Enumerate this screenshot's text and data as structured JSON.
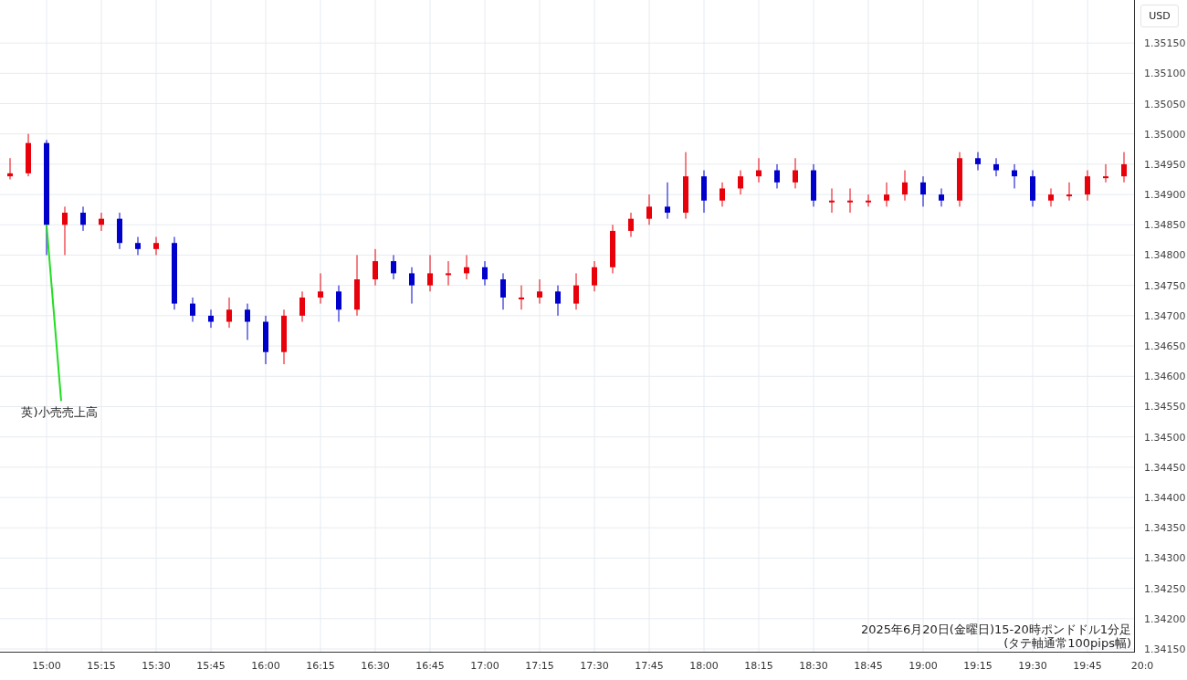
{
  "price_axis": {
    "currency": "USD"
  },
  "chart": {
    "caption": [
      "2025年6月20日(金曜日)15-20時ポンドドル1分足",
      "(タテ軸通常100pips幅)"
    ],
    "chart_data": {
      "type": "candlestick",
      "categories": [
        null,
        null,
        "15:00",
        null,
        null,
        "15:15",
        null,
        null,
        "15:30",
        null,
        null,
        "15:45",
        null,
        null,
        "16:00",
        null,
        null,
        "16:15",
        null,
        null,
        "16:30",
        null,
        null,
        "16:45",
        null,
        null,
        "17:00",
        null,
        null,
        "17:15",
        null,
        null,
        "17:30",
        null,
        null,
        "17:45",
        null,
        null,
        "18:00",
        null,
        null,
        "18:15",
        null,
        null,
        "18:30",
        null,
        null,
        "18:45",
        null,
        null,
        "19:00",
        null,
        null,
        "19:15",
        null,
        null,
        "19:30",
        null,
        null,
        "19:45",
        null,
        null,
        "20:0"
      ],
      "ohlc": [
        [
          1.3493,
          1.3496,
          1.34925,
          1.34935
        ],
        [
          1.34935,
          1.35,
          1.3493,
          1.34985
        ],
        [
          1.34985,
          1.3499,
          1.348,
          1.3485
        ],
        [
          1.3485,
          1.3488,
          1.348,
          1.3487
        ],
        [
          1.3487,
          1.3488,
          1.3484,
          1.3485
        ],
        [
          1.3485,
          1.3487,
          1.3484,
          1.3486
        ],
        [
          1.3486,
          1.3487,
          1.3481,
          1.3482
        ],
        [
          1.3482,
          1.3483,
          1.348,
          1.3481
        ],
        [
          1.3481,
          1.3483,
          1.348,
          1.3482
        ],
        [
          1.3482,
          1.3483,
          1.3471,
          1.3472
        ],
        [
          1.3472,
          1.3473,
          1.3469,
          1.347
        ],
        [
          1.347,
          1.3471,
          1.3468,
          1.3469
        ],
        [
          1.3469,
          1.3473,
          1.3468,
          1.3471
        ],
        [
          1.3471,
          1.3472,
          1.3466,
          1.3469
        ],
        [
          1.3469,
          1.347,
          1.3462,
          1.3464
        ],
        [
          1.3464,
          1.3471,
          1.3462,
          1.347
        ],
        [
          1.347,
          1.3474,
          1.3469,
          1.3473
        ],
        [
          1.3473,
          1.3477,
          1.3472,
          1.3474
        ],
        [
          1.3474,
          1.3475,
          1.3469,
          1.3471
        ],
        [
          1.3471,
          1.348,
          1.347,
          1.3476
        ],
        [
          1.3476,
          1.3481,
          1.3475,
          1.3479
        ],
        [
          1.3479,
          1.348,
          1.3476,
          1.3477
        ],
        [
          1.3477,
          1.3478,
          1.3472,
          1.3475
        ],
        [
          1.3475,
          1.348,
          1.3474,
          1.3477
        ],
        [
          1.3477,
          1.3479,
          1.3475,
          1.3477
        ],
        [
          1.3477,
          1.348,
          1.3476,
          1.3478
        ],
        [
          1.3478,
          1.3479,
          1.3475,
          1.3476
        ],
        [
          1.3476,
          1.3477,
          1.3471,
          1.3473
        ],
        [
          1.3473,
          1.3475,
          1.3471,
          1.3473
        ],
        [
          1.3473,
          1.3476,
          1.3472,
          1.3474
        ],
        [
          1.3474,
          1.3475,
          1.347,
          1.3472
        ],
        [
          1.3472,
          1.3477,
          1.3471,
          1.3475
        ],
        [
          1.3475,
          1.3479,
          1.3474,
          1.3478
        ],
        [
          1.3478,
          1.3485,
          1.3477,
          1.3484
        ],
        [
          1.3484,
          1.3487,
          1.3483,
          1.3486
        ],
        [
          1.3486,
          1.349,
          1.3485,
          1.3488
        ],
        [
          1.3488,
          1.3492,
          1.3486,
          1.3487
        ],
        [
          1.3487,
          1.3497,
          1.3486,
          1.3493
        ],
        [
          1.3493,
          1.3494,
          1.3487,
          1.3489
        ],
        [
          1.3489,
          1.3492,
          1.3488,
          1.3491
        ],
        [
          1.3491,
          1.3494,
          1.349,
          1.3493
        ],
        [
          1.3493,
          1.3496,
          1.3492,
          1.3494
        ],
        [
          1.3494,
          1.3495,
          1.3491,
          1.3492
        ],
        [
          1.3492,
          1.3496,
          1.3491,
          1.3494
        ],
        [
          1.3494,
          1.3495,
          1.3488,
          1.3489
        ],
        [
          1.3489,
          1.3491,
          1.3487,
          1.3489
        ],
        [
          1.3489,
          1.3491,
          1.3487,
          1.3489
        ],
        [
          1.3489,
          1.349,
          1.3488,
          1.3489
        ],
        [
          1.3489,
          1.3492,
          1.3488,
          1.349
        ],
        [
          1.349,
          1.3494,
          1.3489,
          1.3492
        ],
        [
          1.3492,
          1.3493,
          1.3488,
          1.349
        ],
        [
          1.349,
          1.3491,
          1.3488,
          1.3489
        ],
        [
          1.3489,
          1.3497,
          1.3488,
          1.3496
        ],
        [
          1.3496,
          1.3497,
          1.3494,
          1.3495
        ],
        [
          1.3495,
          1.3496,
          1.3493,
          1.3494
        ],
        [
          1.3494,
          1.3495,
          1.3491,
          1.3493
        ],
        [
          1.3493,
          1.3494,
          1.3488,
          1.3489
        ],
        [
          1.3489,
          1.3491,
          1.3488,
          1.349
        ],
        [
          1.349,
          1.3492,
          1.3489,
          1.349
        ],
        [
          1.349,
          1.3494,
          1.3489,
          1.3493
        ],
        [
          1.3493,
          1.3495,
          1.3492,
          1.3493
        ],
        [
          1.3493,
          1.3497,
          1.3492,
          1.3495
        ],
        null
      ],
      "grid": true,
      "ylim": [
        1.34144,
        1.35221
      ],
      "yticks": [
        {
          "value": 1.3515,
          "label": "1.35150"
        },
        {
          "value": 1.351,
          "label": "1.35100"
        },
        {
          "value": 1.3505,
          "label": "1.35050"
        },
        {
          "value": 1.35,
          "label": "1.35000"
        },
        {
          "value": 1.3495,
          "label": "1.34950"
        },
        {
          "value": 1.349,
          "label": "1.34900"
        },
        {
          "value": 1.3485,
          "label": "1.34850"
        },
        {
          "value": 1.348,
          "label": "1.34800"
        },
        {
          "value": 1.3475,
          "label": "1.34750"
        },
        {
          "value": 1.347,
          "label": "1.34700"
        },
        {
          "value": 1.3465,
          "label": "1.34650"
        },
        {
          "value": 1.346,
          "label": "1.34600"
        },
        {
          "value": 1.3455,
          "label": "1.34550"
        },
        {
          "value": 1.345,
          "label": "1.34500"
        },
        {
          "value": 1.3445,
          "label": "1.34450"
        },
        {
          "value": 1.344,
          "label": "1.34400"
        },
        {
          "value": 1.3435,
          "label": "1.34350"
        },
        {
          "value": 1.343,
          "label": "1.34300"
        },
        {
          "value": 1.3425,
          "label": "1.34250"
        },
        {
          "value": 1.342,
          "label": "1.34200"
        },
        {
          "value": 1.3415,
          "label": "1.34150"
        }
      ],
      "annotations": [
        {
          "text": "英)小売売上高",
          "x": "15:00",
          "y": 1.3485
        }
      ]
    }
  }
}
